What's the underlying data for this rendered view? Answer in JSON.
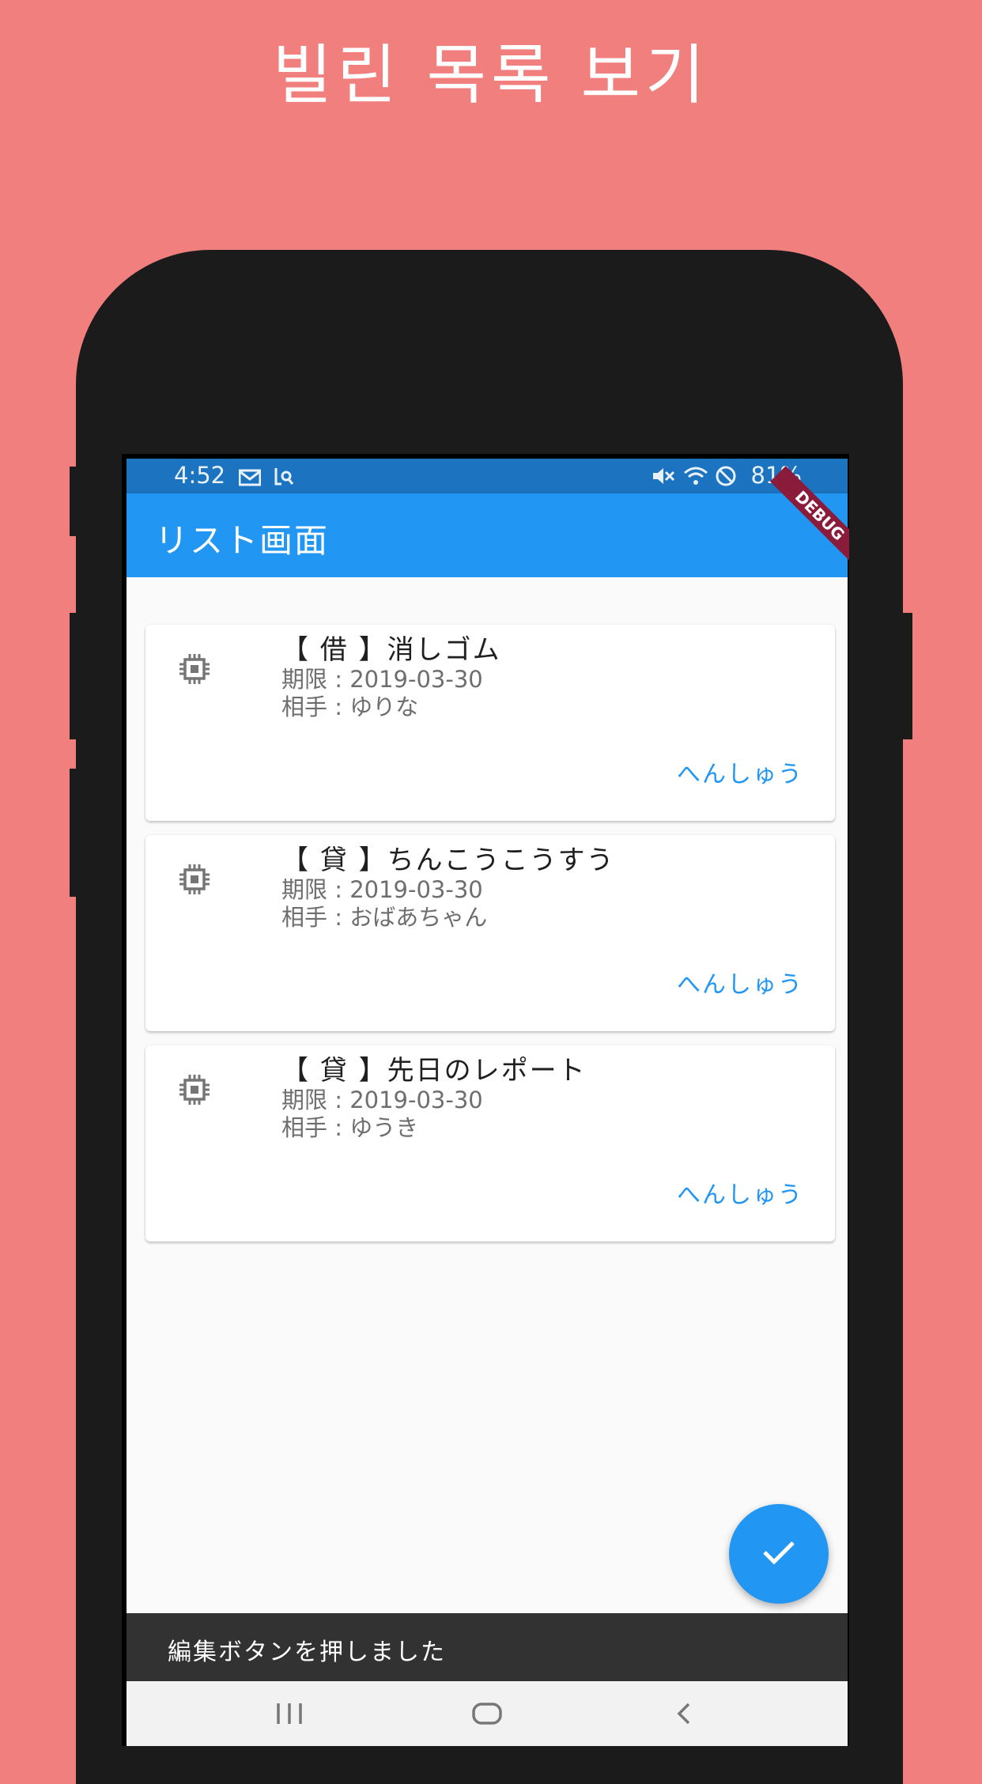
{
  "promo": {
    "title": "빌린 목록 보기"
  },
  "status_bar": {
    "time": "4:52",
    "battery": "81%"
  },
  "app_bar": {
    "title": "リスト画面",
    "debug_banner": "DEBUG"
  },
  "items": [
    {
      "title": "【 借 】消しゴム",
      "due": "期限 : 2019-03-30",
      "partner": "相手 : ゆりな",
      "edit_label": "へんしゅう",
      "icon": "memory-chip-icon"
    },
    {
      "title": "【 貸 】ちんこうこうすう",
      "due": "期限 : 2019-03-30",
      "partner": "相手 : おばあちゃん",
      "edit_label": "へんしゅう",
      "icon": "memory-chip-icon"
    },
    {
      "title": "【 貸 】先日のレポート",
      "due": "期限 : 2019-03-30",
      "partner": "相手 : ゆうき",
      "edit_label": "へんしゅう",
      "icon": "memory-chip-icon"
    }
  ],
  "fab": {
    "icon": "check-icon"
  },
  "snackbar": {
    "message": "編集ボタンを押しました"
  },
  "nav_bar": {
    "icons": [
      "recent-apps-icon",
      "home-icon",
      "back-icon"
    ]
  },
  "colors": {
    "background": "#f07f7d",
    "primary": "#2196f3",
    "status_bar": "#1c73bf",
    "snackbar": "#323232"
  }
}
